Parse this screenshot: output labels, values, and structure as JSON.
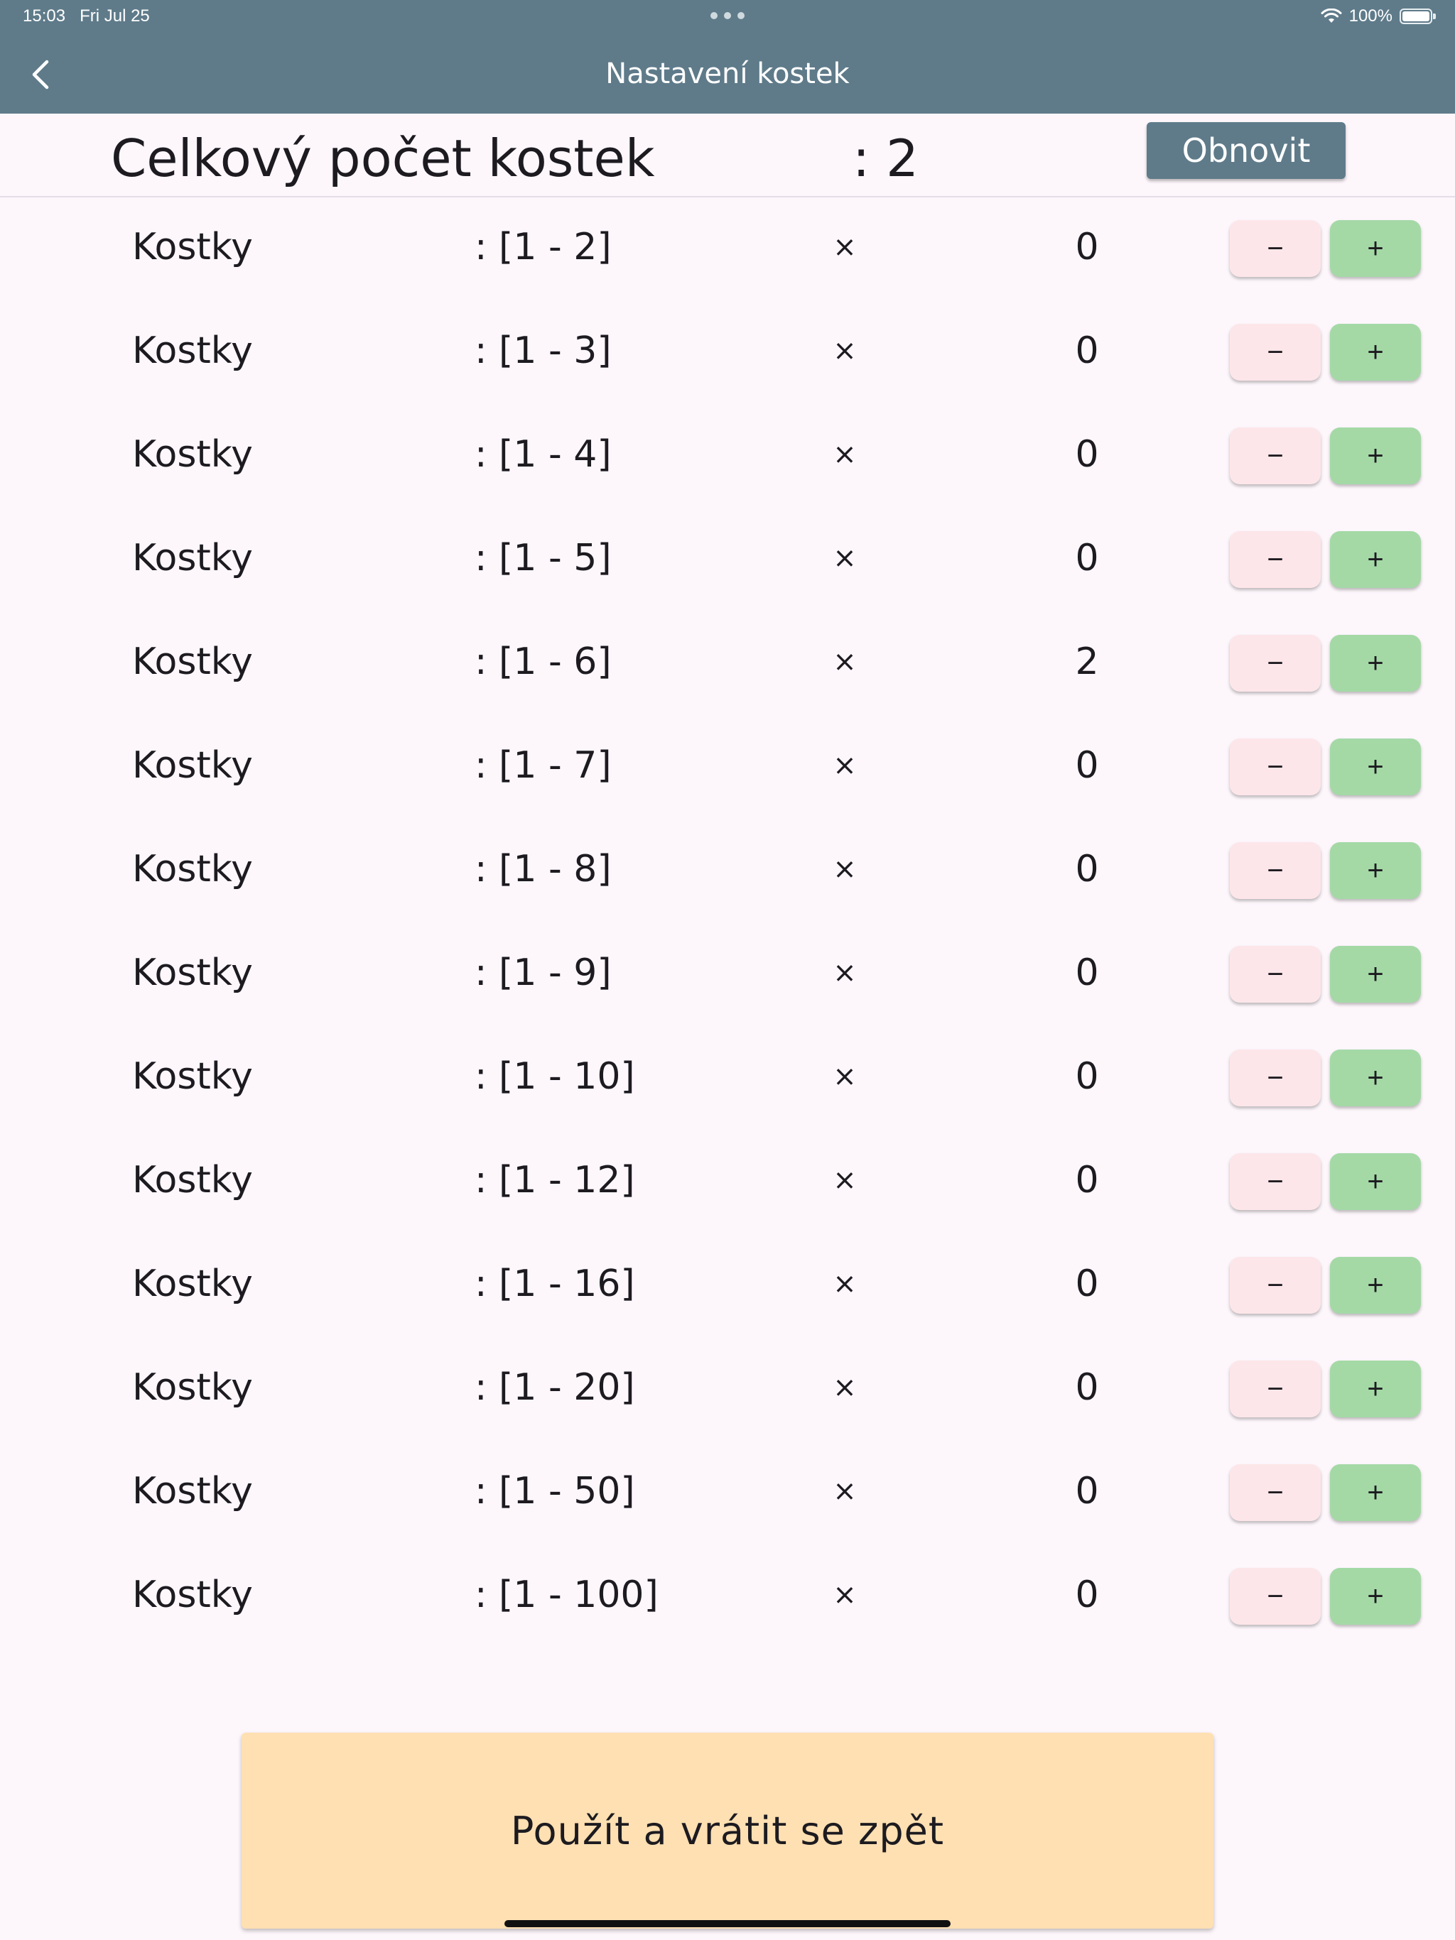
{
  "status_bar": {
    "time": "15:03",
    "date": "Fri Jul 25",
    "battery": "100%"
  },
  "nav": {
    "title": "Nastavení kostek",
    "back_icon": "chevron-left-icon"
  },
  "total": {
    "label": "Celkový počet kostek",
    "value": ": 2",
    "reset_label": "Obnovit"
  },
  "dice": [
    {
      "label": "Kostky",
      "range": ": [1 - 2]",
      "times": "×",
      "count": "0",
      "minus": "−",
      "plus": "+"
    },
    {
      "label": "Kostky",
      "range": ": [1 - 3]",
      "times": "×",
      "count": "0",
      "minus": "−",
      "plus": "+"
    },
    {
      "label": "Kostky",
      "range": ": [1 - 4]",
      "times": "×",
      "count": "0",
      "minus": "−",
      "plus": "+"
    },
    {
      "label": "Kostky",
      "range": ": [1 - 5]",
      "times": "×",
      "count": "0",
      "minus": "−",
      "plus": "+"
    },
    {
      "label": "Kostky",
      "range": ": [1 - 6]",
      "times": "×",
      "count": "2",
      "minus": "−",
      "plus": "+"
    },
    {
      "label": "Kostky",
      "range": ": [1 - 7]",
      "times": "×",
      "count": "0",
      "minus": "−",
      "plus": "+"
    },
    {
      "label": "Kostky",
      "range": ": [1 - 8]",
      "times": "×",
      "count": "0",
      "minus": "−",
      "plus": "+"
    },
    {
      "label": "Kostky",
      "range": ": [1 - 9]",
      "times": "×",
      "count": "0",
      "minus": "−",
      "plus": "+"
    },
    {
      "label": "Kostky",
      "range": ": [1 - 10]",
      "times": "×",
      "count": "0",
      "minus": "−",
      "plus": "+"
    },
    {
      "label": "Kostky",
      "range": ": [1 - 12]",
      "times": "×",
      "count": "0",
      "minus": "−",
      "plus": "+"
    },
    {
      "label": "Kostky",
      "range": ": [1 - 16]",
      "times": "×",
      "count": "0",
      "minus": "−",
      "plus": "+"
    },
    {
      "label": "Kostky",
      "range": ": [1 - 20]",
      "times": "×",
      "count": "0",
      "minus": "−",
      "plus": "+"
    },
    {
      "label": "Kostky",
      "range": ": [1 - 50]",
      "times": "×",
      "count": "0",
      "minus": "−",
      "plus": "+"
    },
    {
      "label": "Kostky",
      "range": ": [1 - 100]",
      "times": "×",
      "count": "0",
      "minus": "−",
      "plus": "+"
    }
  ],
  "apply": {
    "label": "Použít a vrátit se zpět"
  },
  "colors": {
    "header_bg": "#5f7b8a",
    "page_bg": "#fdf7fc",
    "minus_bg": "#fde6e9",
    "plus_bg": "#a4d9a6",
    "apply_bg": "#ffe0b2"
  }
}
